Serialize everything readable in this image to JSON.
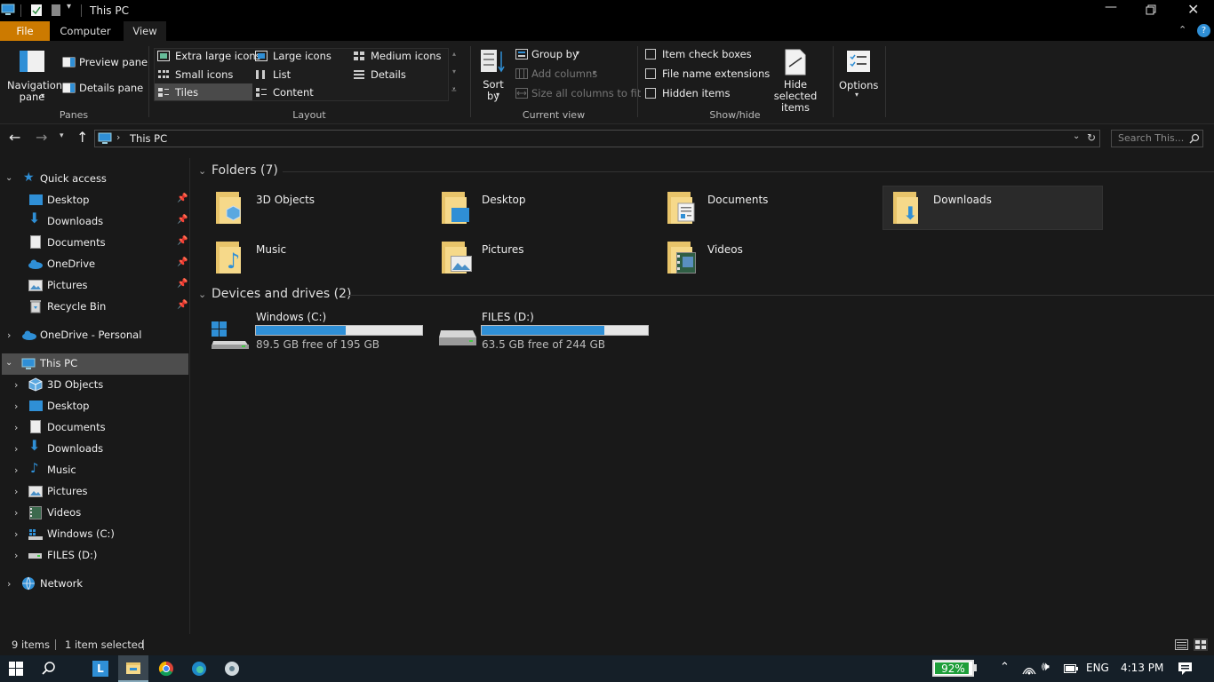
{
  "window": {
    "title": "This PC"
  },
  "tabs": {
    "file": "File",
    "computer": "Computer",
    "view": "View"
  },
  "ribbon": {
    "panes": {
      "navigation_pane": "Navigation pane",
      "preview_pane": "Preview pane",
      "details_pane": "Details pane",
      "group_label": "Panes"
    },
    "layout": {
      "extra_large": "Extra large icons",
      "large": "Large icons",
      "medium": "Medium icons",
      "small": "Small icons",
      "list": "List",
      "details": "Details",
      "tiles": "Tiles",
      "content": "Content",
      "group_label": "Layout"
    },
    "current_view": {
      "sort_by": "Sort by",
      "group_by": "Group by",
      "add_columns": "Add columns",
      "size_columns": "Size all columns to fit",
      "group_label": "Current view"
    },
    "show_hide": {
      "item_check_boxes": "Item check boxes",
      "file_name_extensions": "File name extensions",
      "hidden_items": "Hidden items",
      "hide_selected": "Hide selected items",
      "group_label": "Show/hide"
    },
    "options": "Options"
  },
  "address": {
    "path": "This PC",
    "search_placeholder": "Search This..."
  },
  "nav": {
    "quick_access": "Quick access",
    "quick_items": [
      "Desktop",
      "Downloads",
      "Documents",
      "OneDrive",
      "Pictures",
      "Recycle Bin"
    ],
    "onedrive_personal": "OneDrive - Personal",
    "this_pc": "This PC",
    "pc_items": [
      "3D Objects",
      "Desktop",
      "Documents",
      "Downloads",
      "Music",
      "Pictures",
      "Videos",
      "Windows (C:)",
      "FILES (D:)"
    ],
    "network": "Network"
  },
  "content": {
    "folders_header": "Folders (7)",
    "folders": [
      "3D Objects",
      "Desktop",
      "Documents",
      "Downloads",
      "Music",
      "Pictures",
      "Videos"
    ],
    "devices_header": "Devices and drives (2)",
    "drives": [
      {
        "name": "Windows (C:)",
        "free": "89.5 GB free of 195 GB",
        "used_fraction": 0.541
      },
      {
        "name": "FILES (D:)",
        "free": "63.5 GB free of 244 GB",
        "used_fraction": 0.74
      }
    ]
  },
  "status": {
    "items": "9 items",
    "selected": "1 item selected"
  },
  "taskbar": {
    "battery": "92%",
    "lang": "ENG",
    "time": "4:13 PM"
  },
  "colors": {
    "accent": "#2f8fd6",
    "file_tab": "#cc7a00",
    "battery_green": "#1e9e3a"
  }
}
